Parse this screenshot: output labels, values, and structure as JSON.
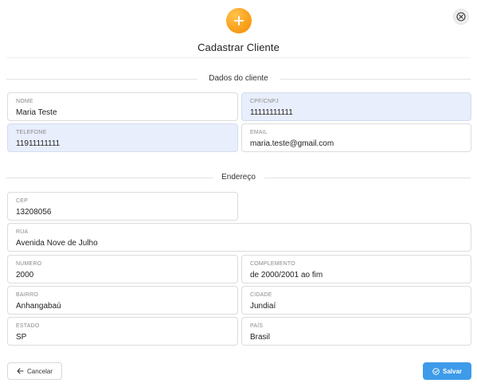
{
  "header": {
    "title": "Cadastrar Cliente",
    "accent_color": "#f9a01b",
    "icon": "plus-icon",
    "close_icon": "close-circle-icon"
  },
  "sections": {
    "client": "Dados do cliente",
    "address": "Endereço"
  },
  "fields": {
    "nome": {
      "label": "NOME",
      "value": "Maria Teste"
    },
    "cpf": {
      "label": "CPF/CNPJ",
      "value": "11111111111"
    },
    "telefone": {
      "label": "TELEFONE",
      "value": "11911111111"
    },
    "email": {
      "label": "EMAIL",
      "value": "maria.teste@gmail.com"
    },
    "cep": {
      "label": "CEP",
      "value": "13208056"
    },
    "rua": {
      "label": "RUA",
      "value": "Avenida Nove de Julho"
    },
    "numero": {
      "label": "NUMERO",
      "value": "2000"
    },
    "complemento": {
      "label": "COMPLEMENTO",
      "value": "de 2000/2001 ao fim"
    },
    "bairro": {
      "label": "BAIRRO",
      "value": "Anhangabaú"
    },
    "cidade": {
      "label": "CIDADE",
      "value": "Jundiaí"
    },
    "estado": {
      "label": "ESTADO",
      "value": "SP"
    },
    "pais": {
      "label": "PAÍS",
      "value": "Brasil"
    }
  },
  "footer": {
    "cancel_label": "Cancelar",
    "cancel_icon": "arrow-left-icon",
    "save_label": "Salvar",
    "save_icon": "check-circle-icon",
    "save_color": "#3d9be9"
  }
}
